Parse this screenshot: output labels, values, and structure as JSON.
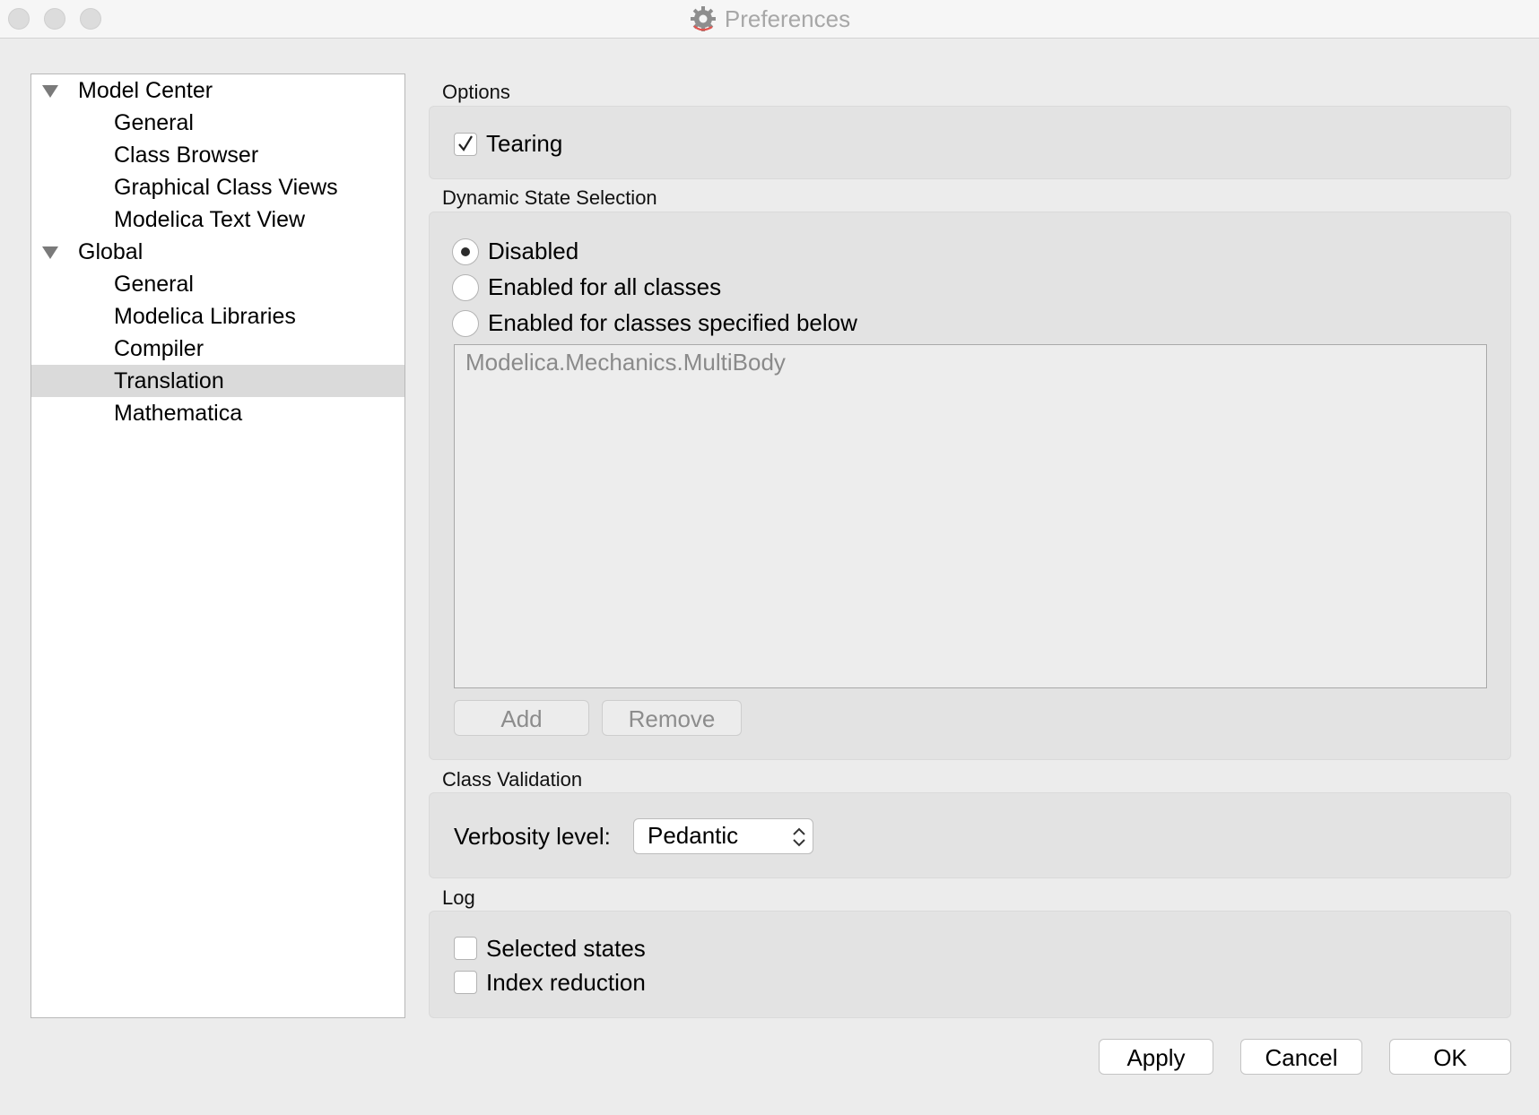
{
  "window": {
    "title": "Preferences",
    "title_icon": "gear-icon"
  },
  "tree": {
    "groups": [
      {
        "label": "Model Center",
        "items": [
          "General",
          "Class Browser",
          "Graphical Class Views",
          "Modelica Text View"
        ]
      },
      {
        "label": "Global",
        "items": [
          "General",
          "Modelica Libraries",
          "Compiler",
          "Translation",
          "Mathematica"
        ]
      }
    ],
    "selected": "Translation"
  },
  "options": {
    "title": "Options",
    "tearing_label": "Tearing",
    "tearing_checked": true
  },
  "dynamic_state": {
    "title": "Dynamic State Selection",
    "radio_disabled": "Disabled",
    "radio_all": "Enabled for all classes",
    "radio_specified": "Enabled for classes specified below",
    "selected_option": "Disabled",
    "list_items": [
      "Modelica.Mechanics.MultiBody"
    ],
    "add_label": "Add",
    "remove_label": "Remove"
  },
  "class_validation": {
    "title": "Class Validation",
    "verbosity_label": "Verbosity level:",
    "verbosity_value": "Pedantic"
  },
  "log": {
    "title": "Log",
    "selected_states_label": "Selected states",
    "selected_states_checked": false,
    "index_reduction_label": "Index reduction",
    "index_reduction_checked": false
  },
  "footer": {
    "apply_label": "Apply",
    "cancel_label": "Cancel",
    "ok_label": "OK"
  }
}
